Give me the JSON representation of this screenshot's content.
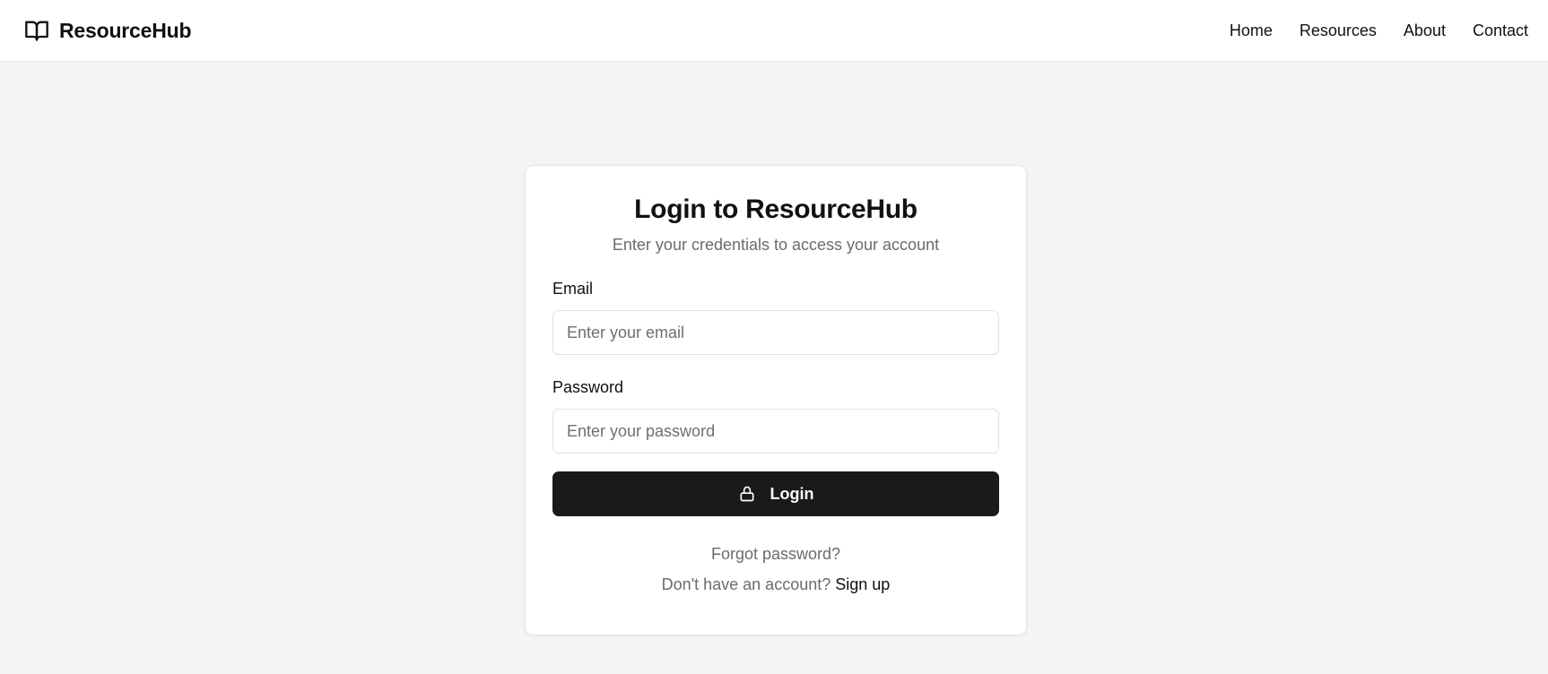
{
  "header": {
    "brand_icon": "book-open-icon",
    "brand_name": "ResourceHub",
    "nav": [
      {
        "label": "Home"
      },
      {
        "label": "Resources"
      },
      {
        "label": "About"
      },
      {
        "label": "Contact"
      }
    ]
  },
  "login": {
    "title": "Login to ResourceHub",
    "subtitle": "Enter your credentials to access your account",
    "email_label": "Email",
    "email_placeholder": "Enter your email",
    "email_value": "",
    "password_label": "Password",
    "password_placeholder": "Enter your password",
    "password_value": "",
    "button_icon": "lock-icon",
    "button_label": "Login",
    "forgot_label": "Forgot password?",
    "signup_prompt": "Don't have an account?",
    "signup_label": "Sign up"
  },
  "colors": {
    "page_background": "#f4f4f4",
    "button_background": "#1a1a1c",
    "muted_text": "#6b6b6b"
  }
}
